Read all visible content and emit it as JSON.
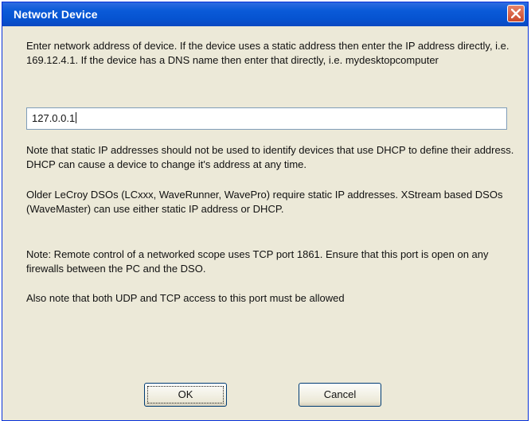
{
  "window": {
    "title": "Network Device",
    "close_icon": "close-icon"
  },
  "instructions": "Enter network address of device. If the device uses a static address then enter the IP address directly, i.e. 169.12.4.1. If the device has a DNS name then enter that directly, i.e. mydesktopcomputer",
  "address_field": {
    "value": "127.0.0.1"
  },
  "notes": {
    "dhcp": "Note that static IP addresses should not be used to identify devices that use DHCP to define their address. DHCP can cause a device to change it's address at any time.",
    "older_dsos": "Older LeCroy DSOs (LCxxx, WaveRunner, WavePro) require static IP addresses. XStream based DSOs (WaveMaster) can use either static IP address or DHCP.",
    "remote_control": "Note: Remote control of a networked scope uses TCP port 1861. Ensure that this port is open on any firewalls between the PC and the DSO.",
    "udp_tcp": "Also note that both UDP and TCP access to this port must be allowed"
  },
  "buttons": {
    "ok_label": "OK",
    "cancel_label": "Cancel"
  },
  "colors": {
    "titlebar": "#0653d0",
    "dialog_bg": "#ece9d8",
    "close_button": "#d1552f"
  }
}
